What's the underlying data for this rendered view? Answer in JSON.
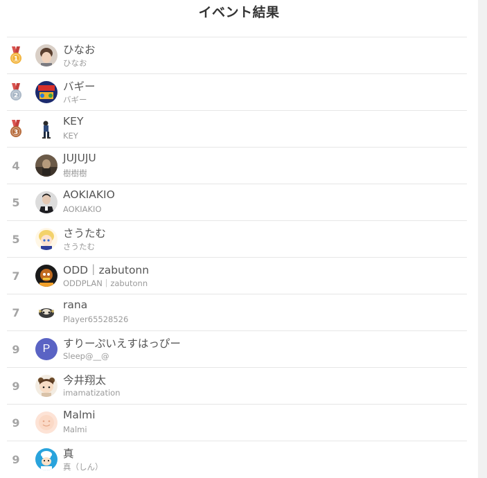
{
  "page": {
    "title": "イベント結果"
  },
  "colors": {
    "gold": "#f2b33a",
    "silver": "#a9b7c6",
    "bronze": "#b66a3a",
    "ribbon": "#d9534f",
    "rank_text": "#a5a5a5"
  },
  "rows": [
    {
      "rank": "1",
      "medal": "gold",
      "name": "ひなお",
      "sub": "ひなお",
      "avatar": "photo-boy"
    },
    {
      "rank": "2",
      "medal": "silver",
      "name": "バギー",
      "sub": "バギー",
      "avatar": "game-art"
    },
    {
      "rank": "3",
      "medal": "bronze",
      "name": "KEY",
      "sub": "KEY",
      "avatar": "figure"
    },
    {
      "rank": "4",
      "medal": "",
      "name": "JUJUJU",
      "sub": "樹樹樹",
      "avatar": "photo-dark"
    },
    {
      "rank": "5",
      "medal": "",
      "name": "AOKIAKIO",
      "sub": "AOKIAKIO",
      "avatar": "photo-man"
    },
    {
      "rank": "5",
      "medal": "",
      "name": "さうたむ",
      "sub": "さうたむ",
      "avatar": "anime-blonde"
    },
    {
      "rank": "7",
      "medal": "",
      "name": "ODD｜zabutonn",
      "sub": "ODDPLAN｜zabutonn",
      "avatar": "anime-dark"
    },
    {
      "rank": "7",
      "medal": "",
      "name": "rana",
      "sub": "Player65528526",
      "avatar": "creature"
    },
    {
      "rank": "9",
      "medal": "",
      "name": "すりーぷいえすはっぴー",
      "sub": "Sleep@__@",
      "avatar": "letter",
      "avatar_letter": "P"
    },
    {
      "rank": "9",
      "medal": "",
      "name": "今井翔太",
      "sub": "imamatization",
      "avatar": "anime-bear"
    },
    {
      "rank": "9",
      "medal": "",
      "name": "Malmi",
      "sub": "Malmi",
      "avatar": "smiley"
    },
    {
      "rank": "9",
      "medal": "",
      "name": "真",
      "sub": "真（しん）",
      "avatar": "chef"
    }
  ]
}
